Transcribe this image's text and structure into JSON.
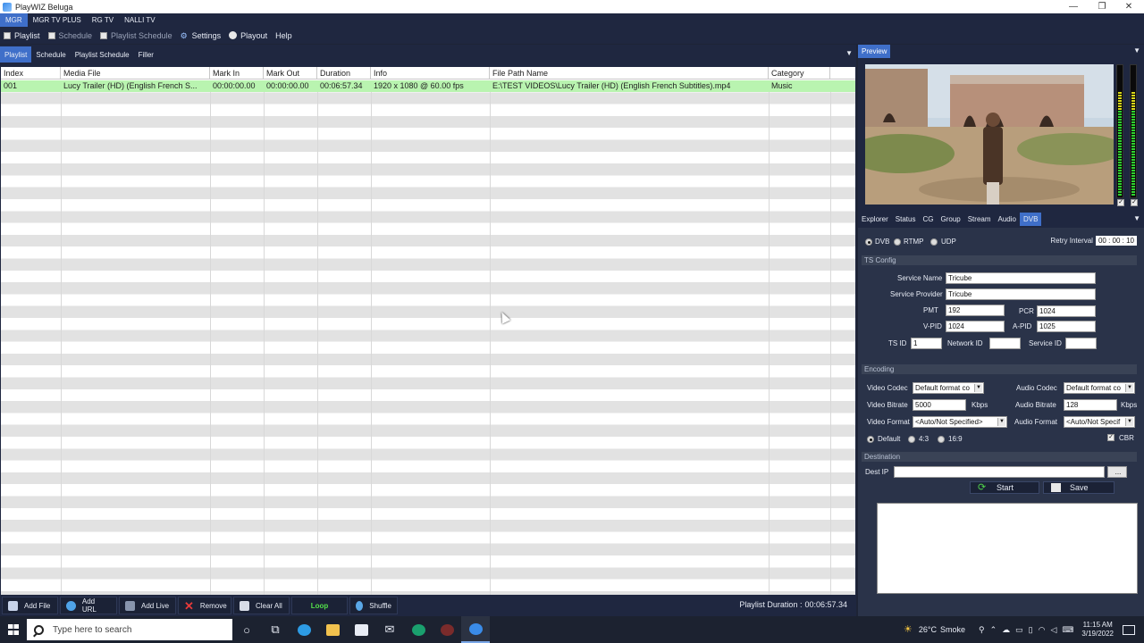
{
  "window": {
    "title": "PlayWIZ Beluga",
    "minimize": "—",
    "maximize": "❐",
    "close": "✕"
  },
  "channels": [
    {
      "label": "MGR",
      "active": true
    },
    {
      "label": "MGR TV PLUS",
      "active": false
    },
    {
      "label": "RG TV",
      "active": false
    },
    {
      "label": "NALLI TV",
      "active": false
    }
  ],
  "menu": {
    "playlist": "Playlist",
    "schedule": "Schedule",
    "playlist_schedule": "Playlist Schedule",
    "settings": "Settings",
    "playout": "Playout",
    "help": "Help"
  },
  "left_tabs": [
    "Playlist",
    "Schedule",
    "Playlist Schedule",
    "Filler"
  ],
  "table": {
    "columns": [
      "Index",
      "Media File",
      "Mark In",
      "Mark Out",
      "Duration",
      "Info",
      "File Path Name",
      "Category"
    ],
    "rows": [
      [
        "001",
        "Lucy Trailer (HD) (English French S...",
        "00:00:00.00",
        "00:00:00.00",
        "00:06:57.34",
        "1920 x 1080 @ 60.00 fps",
        "E:\\TEST VIDEOS\\Lucy Trailer (HD) (English French Subtitles).mp4",
        "Music"
      ]
    ]
  },
  "bottom_buttons": {
    "add_file": "Add File",
    "add_url": "Add URL",
    "add_live": "Add Live",
    "remove": "Remove",
    "clear_all": "Clear All",
    "loop": "Loop",
    "shuffle": "Shuffle"
  },
  "playlist_duration": {
    "label": "Playlist Duration :",
    "value": "00:06:57.34"
  },
  "preview": {
    "tab": "Preview"
  },
  "right_tabs": [
    "Explorer",
    "Status",
    "CG",
    "Group",
    "Stream",
    "Audio",
    "DVB"
  ],
  "output": {
    "modes": [
      "DVB",
      "RTMP",
      "UDP"
    ],
    "selected_mode": "DVB",
    "retry_label": "Retry Interval",
    "retry_value": "00 : 00 : 10"
  },
  "ts_config": {
    "section": "TS Config",
    "service_name_label": "Service Name",
    "service_name": "Tricube",
    "service_provider_label": "Service Provider",
    "service_provider": "Tricube",
    "pmt_label": "PMT",
    "pmt": "192",
    "pcr_label": "PCR",
    "pcr": "1024",
    "vpid_label": "V-PID",
    "vpid": "1024",
    "apid_label": "A-PID",
    "apid": "1025",
    "tsid_label": "TS ID",
    "tsid": "1",
    "network_id_label": "Network ID",
    "network_id": "",
    "service_id_label": "Service ID",
    "service_id": ""
  },
  "encoding": {
    "section": "Encoding",
    "video_codec_label": "Video Codec",
    "video_codec": "Default format co",
    "audio_codec_label": "Audio Codec",
    "audio_codec": "Default format co",
    "video_bitrate_label": "Video Bitrate",
    "video_bitrate": "5000",
    "video_bitrate_unit": "Kbps",
    "audio_bitrate_label": "Audio Bitrate",
    "audio_bitrate": "128",
    "audio_bitrate_unit": "Kbps",
    "video_format_label": "Video Format",
    "video_format": "<Auto/Not Specified>",
    "audio_format_label": "Audio Format",
    "audio_format": "<Auto/Not Specif",
    "aspects": [
      "Default",
      "4:3",
      "16:9"
    ],
    "selected_aspect": "Default",
    "cbr_label": "CBR",
    "cbr_checked": true
  },
  "destination": {
    "section": "Destination",
    "dest_ip_label": "Dest IP",
    "dest_ip": "",
    "browse": "...",
    "start": "Start",
    "save": "Save"
  },
  "taskbar": {
    "search_placeholder": "Type here to search",
    "weather": {
      "temp": "26°C",
      "condition": "Smoke"
    },
    "time": "11:15 AM",
    "date": "3/19/2022"
  },
  "colors": {
    "accent": "#3f6fc9",
    "panel": "#1f2740",
    "selected_row": "#b9f4b0",
    "loop_text": "#53e04a"
  }
}
